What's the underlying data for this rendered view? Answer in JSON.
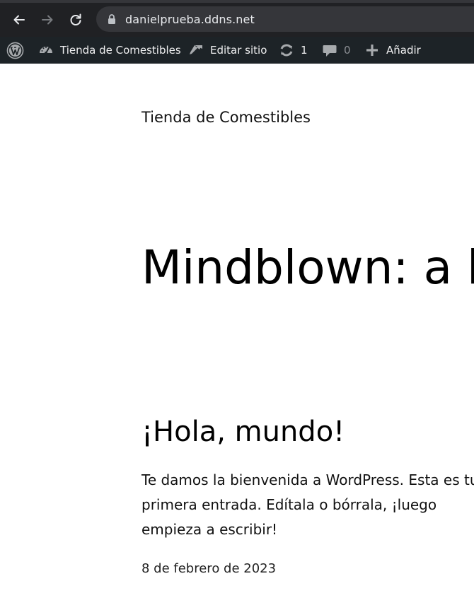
{
  "browser": {
    "url": "danielprueba.ddns.net"
  },
  "admin_bar": {
    "site_name": "Tienda de Comestibles",
    "edit_site": "Editar sitio",
    "updates_count": "1",
    "comments_count": "0",
    "add_new": "Añadir"
  },
  "page": {
    "site_title": "Tienda de Comestibles",
    "hero_heading": "Mindblown: a b",
    "post": {
      "title": "¡Hola, mundo!",
      "excerpt_lines": [
        "Te damos la bienvenida a WordPress. Esta es tu",
        "primera entrada. Edítala o bórrala, ¡luego",
        "empieza a escribir!"
      ],
      "date": "8 de febrero de 2023"
    }
  }
}
